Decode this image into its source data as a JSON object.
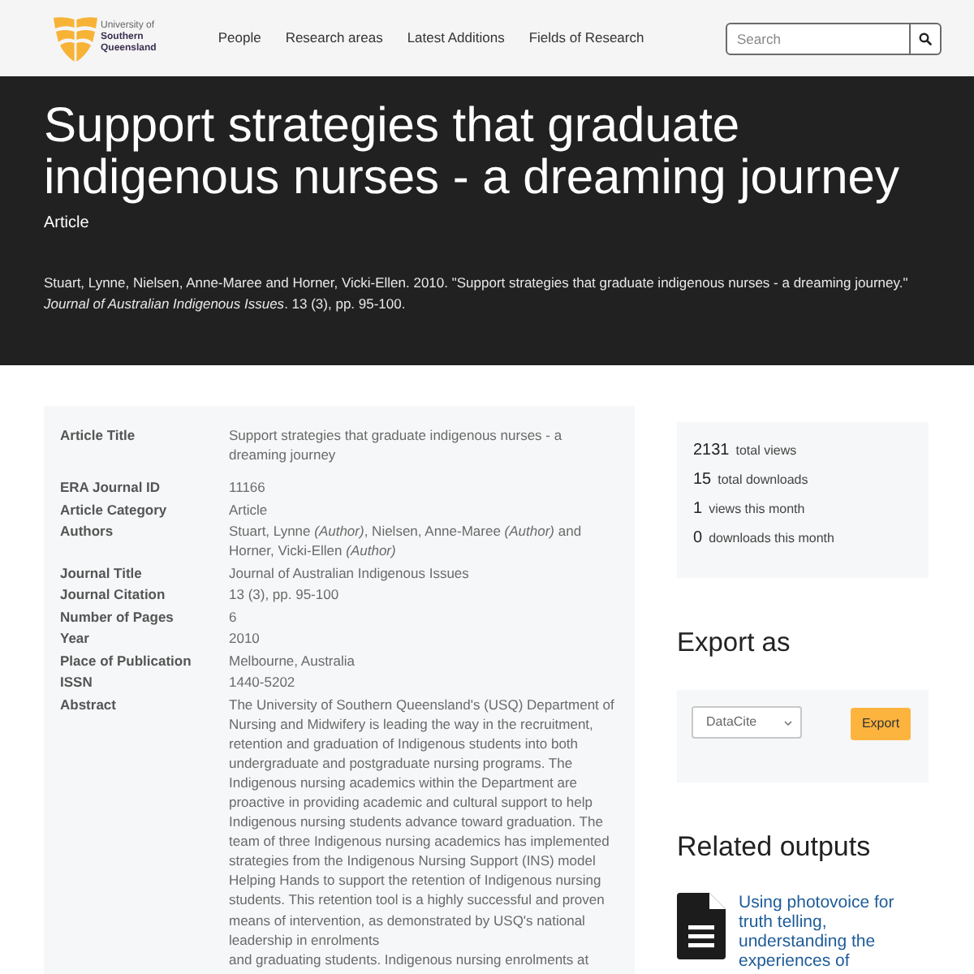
{
  "header": {
    "logo": {
      "small_line": "University of",
      "name_lines": [
        "Southern",
        "Queensland"
      ]
    },
    "nav": [
      {
        "label": "People"
      },
      {
        "label": "Research areas"
      },
      {
        "label": "Latest Additions"
      },
      {
        "label": "Fields of Research"
      }
    ],
    "search": {
      "placeholder": "Search"
    }
  },
  "hero": {
    "title": "Support strategies that graduate indigenous nurses - a dreaming journey",
    "type": "Article",
    "citation": "Stuart, Lynne, Nielsen, Anne-Maree and Horner, Vicki-Ellen. 2010. \"Support strategies that graduate indigenous nurses - a dreaming journey.\" *Journal of Australian Indigenous Issues*. 13 (3), pp. 95-100."
  },
  "details": [
    {
      "rows": [
        {
          "label": "Article Title",
          "value": "Support strategies that graduate indigenous nurses - a dreaming journey"
        }
      ]
    },
    {
      "rows": [
        {
          "label": "ERA Journal ID",
          "value": "11166"
        },
        {
          "label": "Article Category",
          "value": "Article"
        },
        {
          "label": "Authors",
          "value": "Stuart, Lynne *(Author)*, Nielsen, Anne-Maree *(Author)* and Horner, Vicki-Ellen *(Author)*"
        },
        {
          "label": "Journal Title",
          "value": "Journal of Australian Indigenous Issues"
        },
        {
          "label": "Journal Citation",
          "value": "13 (3), pp. 95-100"
        },
        {
          "label": "Number of Pages",
          "value": "6"
        },
        {
          "label": "Year",
          "value": "2010"
        },
        {
          "label": "Place of Publication",
          "value": "Melbourne, Australia"
        },
        {
          "label": "ISSN",
          "value": "1440-5202"
        },
        {
          "label": "Abstract",
          "paragraphs": [
            "The University of Southern Queensland's (USQ) Department of Nursing and Midwifery is leading the way in the recruitment, retention and graduation of Indigenous students into both undergraduate and postgraduate nursing programs. The Indigenous nursing academics within the Department are proactive in providing academic and cultural support to help Indigenous nursing students advance toward graduation. The team of three Indigenous nursing academics has implemented strategies from the Indigenous Nursing Support (INS) model Helping Hands to support the retention of Indigenous nursing students. This retention tool is a highly successful and proven means of intervention, as demonstrated by USQ's national leadership in enrolments",
            "and graduating students. Indigenous nursing enrolments at"
          ]
        }
      ]
    }
  ],
  "stats": [
    {
      "count": "2131",
      "label": "total views"
    },
    {
      "count": "15",
      "label": "total downloads"
    },
    {
      "count": "1",
      "label": "views this month"
    },
    {
      "count": "0",
      "label": "downloads this month"
    }
  ],
  "export": {
    "heading": "Export as",
    "format": "DataCite",
    "button": "Export"
  },
  "related": {
    "heading": "Related outputs",
    "items": [
      {
        "title": "Using photovoice for truth telling, understanding the experiences of"
      }
    ]
  }
}
